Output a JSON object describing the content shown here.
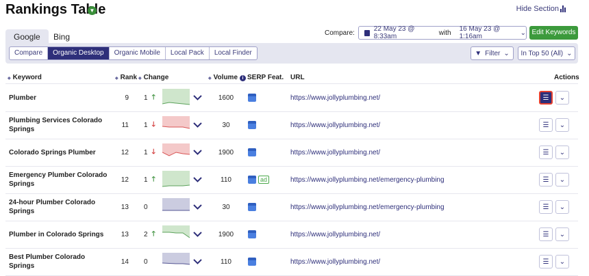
{
  "header": {
    "title": "Rankings Table",
    "hide_section": "Hide Section"
  },
  "engines": [
    {
      "label": "Google",
      "active": true
    },
    {
      "label": "Bing",
      "active": false
    }
  ],
  "views": [
    {
      "label": "Compare"
    },
    {
      "label": "Organic Desktop",
      "active": true
    },
    {
      "label": "Organic Mobile"
    },
    {
      "label": "Local Pack"
    },
    {
      "label": "Local Finder"
    }
  ],
  "compare": {
    "label": "Compare:",
    "date1": "22 May 23 @ 8:33am",
    "with": "with",
    "date2": "16 May 23 @ 1:16am"
  },
  "edit_keywords": "Edit Keywords",
  "filter": "Filter",
  "top_filter": "In Top 50 (All)",
  "columns": {
    "keyword": "Keyword",
    "rank": "Rank",
    "change": "Change",
    "volume": "Volume",
    "serp": "SERP Feat.",
    "url": "URL",
    "actions": "Actions"
  },
  "colors": {
    "up": "#3a8f3a",
    "down": "#d03030",
    "flat": "#2e2f7a"
  },
  "rows": [
    {
      "keyword": "Plumber",
      "rank": "9",
      "change": "1",
      "dir": "up",
      "volume": "1600",
      "ad": "",
      "url": "https://www.jollyplumbing.net/"
    },
    {
      "keyword": "Plumbing Services Colorado Springs",
      "rank": "11",
      "change": "1",
      "dir": "down",
      "volume": "30",
      "ad": "",
      "url": "https://www.jollyplumbing.net/"
    },
    {
      "keyword": "Colorado Springs Plumber",
      "rank": "12",
      "change": "1",
      "dir": "down",
      "volume": "1900",
      "ad": "",
      "url": "https://www.jollyplumbing.net/"
    },
    {
      "keyword": "Emergency Plumber Colorado Springs",
      "rank": "12",
      "change": "1",
      "dir": "up",
      "volume": "110",
      "ad": "ad",
      "url": "https://www.jollyplumbing.net/emergency-plumbing"
    },
    {
      "keyword": "24-hour Plumber Colorado Springs",
      "rank": "13",
      "change": "0",
      "dir": "flat",
      "volume": "30",
      "ad": "",
      "url": "https://www.jollyplumbing.net/emergency-plumbing"
    },
    {
      "keyword": "Plumber in Colorado Springs",
      "rank": "13",
      "change": "2",
      "dir": "up",
      "volume": "1900",
      "ad": "",
      "url": "https://www.jollyplumbing.net/"
    },
    {
      "keyword": "Best Plumber Colorado Springs",
      "rank": "14",
      "change": "0",
      "dir": "flat",
      "volume": "110",
      "ad": "",
      "url": "https://www.jollyplumbing.net/"
    }
  ]
}
